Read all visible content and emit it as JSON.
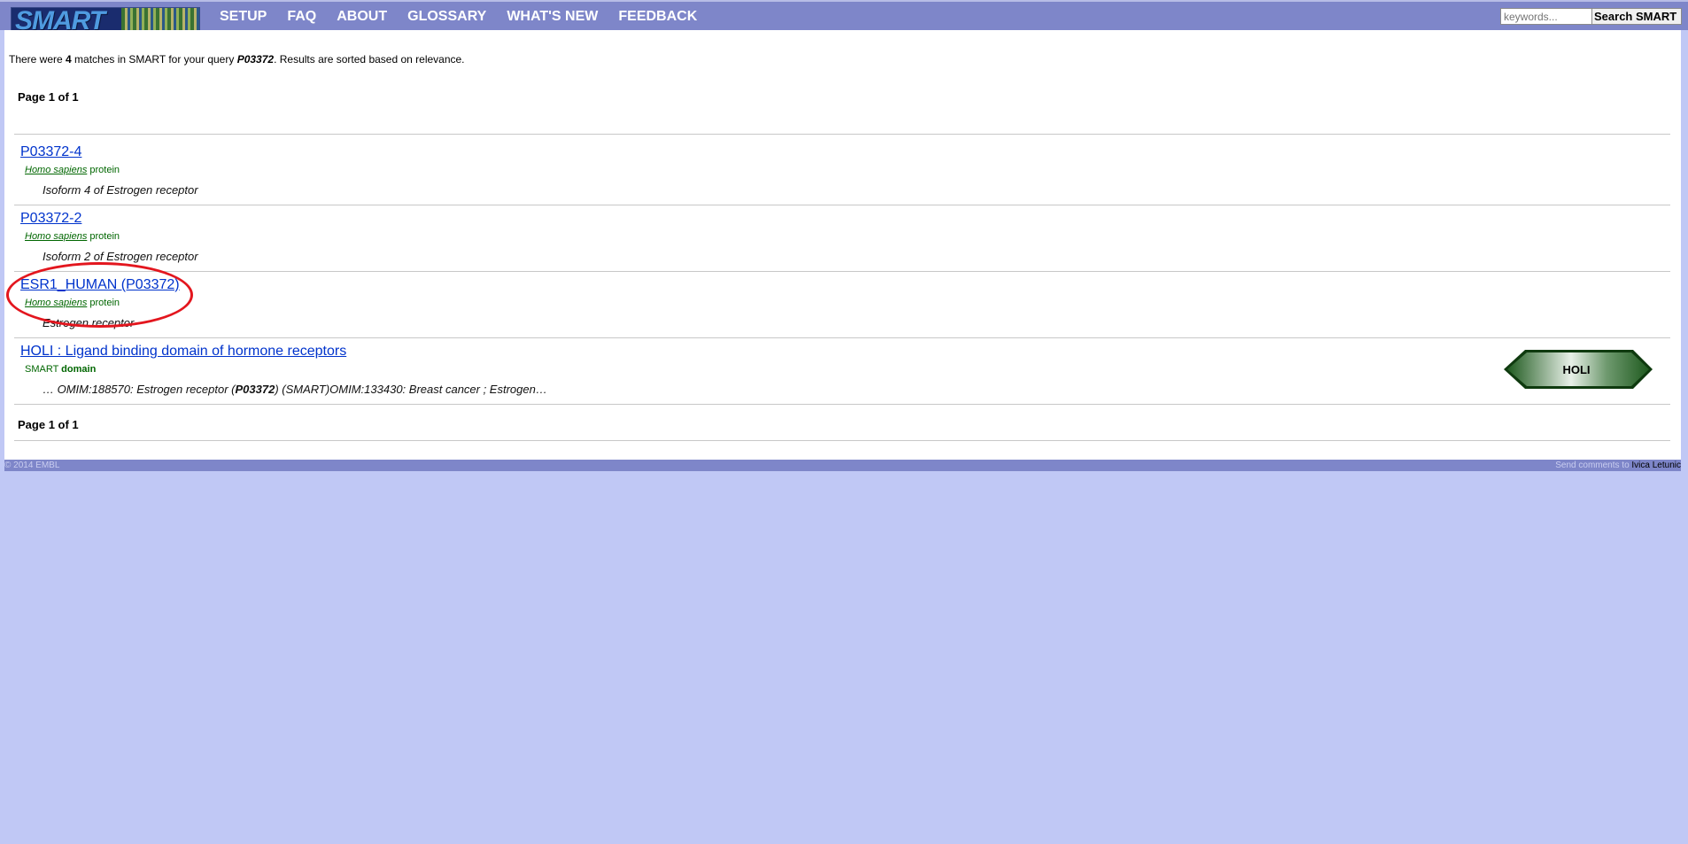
{
  "header": {
    "logo_text": "SMART",
    "nav": [
      "SETUP",
      "FAQ",
      "ABOUT",
      "GLOSSARY",
      "WHAT'S NEW",
      "FEEDBACK"
    ],
    "search_placeholder": "keywords...",
    "search_button": "Search SMART"
  },
  "summary": {
    "pre": "There were ",
    "count": "4",
    "mid": " matches in SMART for your query ",
    "query": "P03372",
    "post": ". Results are sorted based on relevance."
  },
  "pager": {
    "pre": "Page ",
    "current": "1",
    "mid": " of ",
    "total": "1"
  },
  "results": [
    {
      "title": "P03372-4",
      "species": "Homo sapiens",
      "type": "protein",
      "description": "Isoform 4 of Estrogen receptor"
    },
    {
      "title": "P03372-2",
      "species": "Homo sapiens",
      "type": "protein",
      "description": "Isoform 2 of Estrogen receptor"
    },
    {
      "title": "ESR1_HUMAN (P03372)",
      "species": "Homo sapiens",
      "type": "protein",
      "description": "Estrogen receptor"
    },
    {
      "title": "HOLI : Ligand binding domain of hormone receptors",
      "species": "SMART",
      "type": "domain",
      "desc_pre": "… OMIM:188570: Estrogen receptor (",
      "desc_bold": "P03372",
      "desc_post": ") (SMART)OMIM:133430: Breast cancer ; Estrogen…",
      "domain_label": "HOLI"
    }
  ],
  "footer": {
    "copyright": "© 2014 EMBL",
    "comments": "Send comments to ",
    "contact": "Ivica Letunic"
  },
  "colors": {
    "page_background": "#c0c8f5",
    "bar": "#7e86c9",
    "link": "#0033cc",
    "species": "#006600",
    "annotation": "#e3161e",
    "domain_fill": "#1f5a1f"
  }
}
